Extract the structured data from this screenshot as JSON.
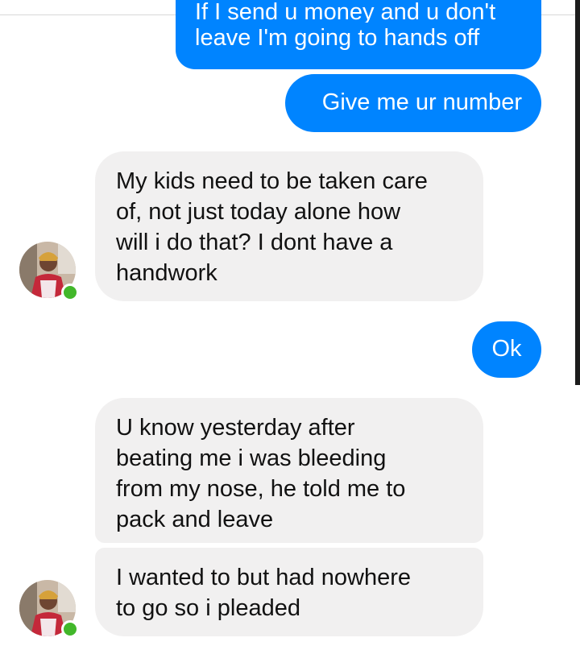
{
  "thread": {
    "messages": [
      {
        "from": "me",
        "text": "If I send u money and u don't"
      },
      {
        "from": "me",
        "text": "leave I'm going to hands off"
      },
      {
        "from": "me",
        "text": "Give me ur number"
      },
      {
        "from": "contact",
        "lines": [
          "My kids need to be taken care",
          "of, not just today alone how",
          "will i do that? I dont have a",
          "handwork"
        ]
      },
      {
        "from": "me",
        "text": "Ok"
      },
      {
        "from": "contact",
        "lines": [
          "U know yesterday after",
          "beating me i was bleeding",
          "from my nose, he told me to",
          "pack and leave"
        ]
      },
      {
        "from": "contact",
        "lines": [
          "I wanted to but had nowhere",
          "to go so i pleaded"
        ]
      }
    ]
  },
  "contact": {
    "avatar_icon": "profile-photo",
    "status_icon": "online-indicator-icon"
  },
  "colors": {
    "outgoing_bubble": "#0084ff",
    "incoming_bubble": "#f1f0f0",
    "online": "#42b72a"
  }
}
